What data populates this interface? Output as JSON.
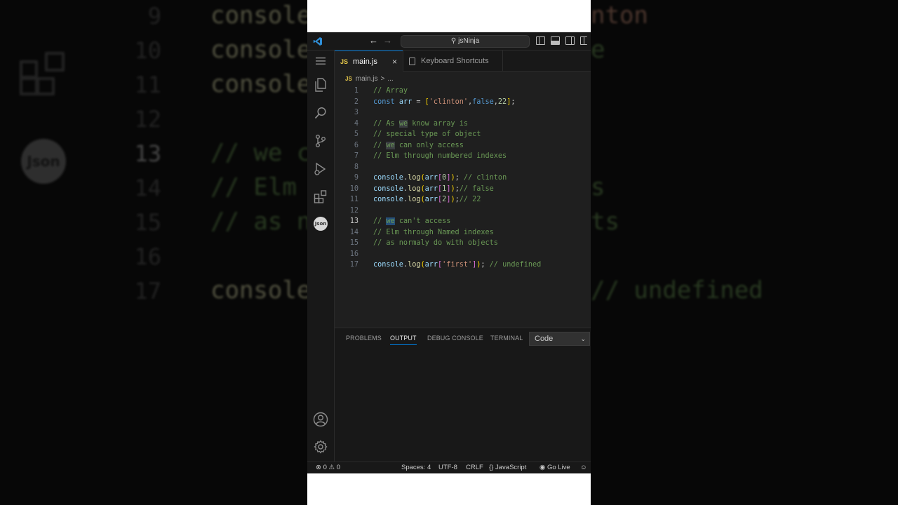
{
  "background": {
    "lines": [
      {
        "num": "9",
        "text": "console"
      },
      {
        "num": "10",
        "text": "console"
      },
      {
        "num": "11",
        "text": "console"
      },
      {
        "num": "12",
        "text": ""
      },
      {
        "num": "13",
        "text": "// we c"
      },
      {
        "num": "14",
        "text": "// Elm"
      },
      {
        "num": "15",
        "text": "// as n"
      },
      {
        "num": "16",
        "text": ""
      },
      {
        "num": "17",
        "text": "console"
      }
    ],
    "right_fragments": [
      "nton",
      "e",
      "s",
      "ts",
      "// undefined"
    ],
    "json_badge": "Json"
  },
  "titlebar": {
    "search_label": "jsNinja"
  },
  "tabs": [
    {
      "badge": "JS",
      "label": "main.js",
      "close": "×"
    },
    {
      "label": "Keyboard Shortcuts"
    }
  ],
  "breadcrumb": {
    "badge": "JS",
    "file": "main.js",
    "separator": ">",
    "more": "..."
  },
  "activity": {
    "json_badge": "Json"
  },
  "code": {
    "line_numbers": [
      "1",
      "2",
      "3",
      "4",
      "5",
      "6",
      "7",
      "8",
      "9",
      "10",
      "11",
      "12",
      "13",
      "14",
      "15",
      "16",
      "17"
    ],
    "active_line": "13",
    "tokens": {
      "l1": "// Array",
      "l2_kw": "const",
      "l2_var": "arr",
      "l2_eq": " = ",
      "l2_open": "[",
      "l2_str": "'clinton'",
      "l2_comma1": ",",
      "l2_false": "false",
      "l2_comma2": ",",
      "l2_num": "22",
      "l2_close": "]",
      "l2_semi": ";",
      "l4_a": "// As ",
      "l4_we": "we",
      "l4_b": " know array is",
      "l5": "// special type of object",
      "l6_a": "// ",
      "l6_we": "we",
      "l6_b": " can only access",
      "l7": "// Elm through numbered indexes",
      "console": "console",
      "dot": ".",
      "log": "log",
      "paren_open": "(",
      "paren_close": ")",
      "arr": "arr",
      "br_open": "[",
      "br_close": "]",
      "semi": ";",
      "idx0": "0",
      "idx1": "1",
      "idx2": "2",
      "c9": " // clinton",
      "c10": "// false",
      "c11": "// 22",
      "l13_a": "// ",
      "l13_we": "we",
      "l13_b": " can't access",
      "l14": "// Elm through Named indexes",
      "l15": "// as normaly do with objects",
      "str_first": "'first'",
      "c17": " // undefined"
    }
  },
  "panel": {
    "tabs": [
      "PROBLEMS",
      "OUTPUT",
      "DEBUG CONSOLE",
      "TERMINAL"
    ],
    "active_tab": "OUTPUT",
    "select_value": "Code",
    "select_chevron": "⌄"
  },
  "status": {
    "errors": "0",
    "warnings": "0",
    "spaces": "Spaces: 4",
    "encoding": "UTF-8",
    "eol": "CRLF",
    "language": "JavaScript",
    "golive": "Go Live"
  },
  "colors": {
    "accent": "#0078d4",
    "editor_bg": "#1f1f1f",
    "chrome_bg": "#181818",
    "comment": "#6a9955",
    "keyword": "#569cd6",
    "string": "#ce9178"
  }
}
